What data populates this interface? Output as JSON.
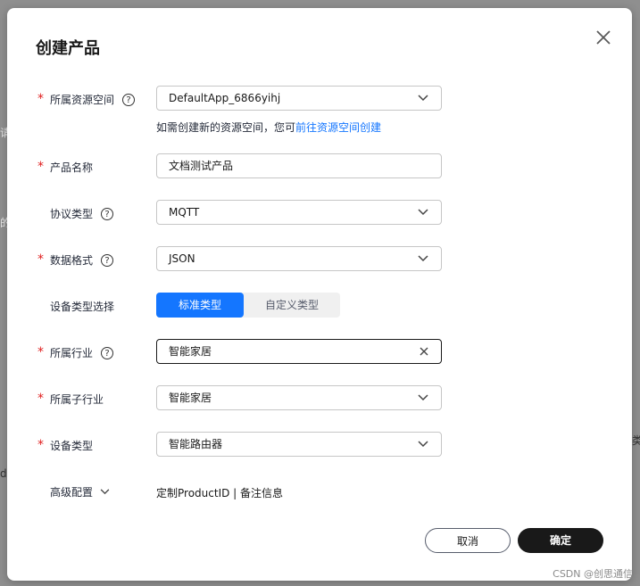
{
  "dialog": {
    "title": "创建产品",
    "close_label": "关闭"
  },
  "fields": {
    "space": {
      "label": "所属资源空间",
      "value": "DefaultApp_6866yihj"
    },
    "space_hint": {
      "prefix": "如需创建新的资源空间，您可",
      "link": "前往资源空间创建"
    },
    "name": {
      "label": "产品名称",
      "value": "文档测试产品"
    },
    "protocol": {
      "label": "协议类型",
      "value": "MQTT"
    },
    "format": {
      "label": "数据格式",
      "value": "JSON"
    },
    "device_type_choice": {
      "label": "设备类型选择",
      "options": [
        "标准类型",
        "自定义类型"
      ]
    },
    "industry": {
      "label": "所属行业",
      "value": "智能家居"
    },
    "sub_industry": {
      "label": "所属子行业",
      "value": "智能家居"
    },
    "device_type": {
      "label": "设备类型",
      "value": "智能路由器"
    },
    "advanced": {
      "label": "高级配置",
      "text": "定制ProductID | 备注信息"
    }
  },
  "buttons": {
    "cancel": "取消",
    "ok": "确定"
  },
  "required_mark": "*",
  "help_glyph": "?",
  "watermark": "CSDN @创思通信",
  "colors": {
    "primary": "#1476ff",
    "dark": "#191919",
    "required": "#e02020"
  }
}
